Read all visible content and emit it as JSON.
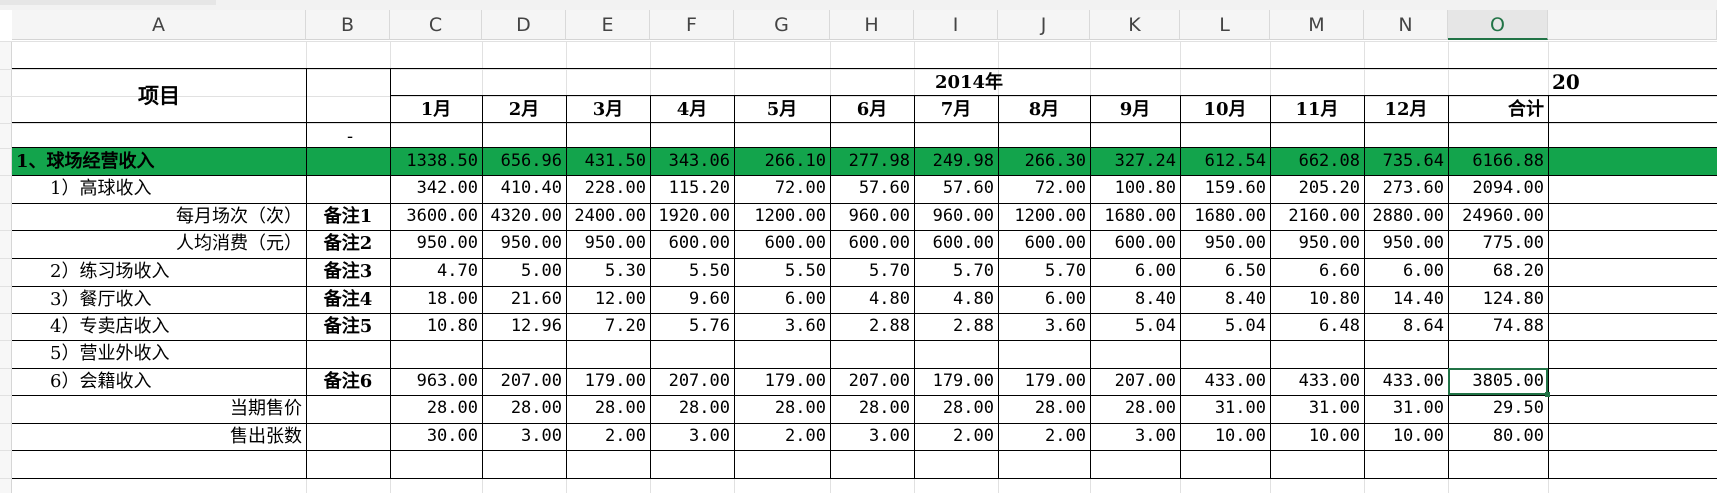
{
  "columns": [
    "A",
    "B",
    "C",
    "D",
    "E",
    "F",
    "G",
    "H",
    "I",
    "J",
    "K",
    "L",
    "M",
    "N",
    "O"
  ],
  "selected_column": "O",
  "header": {
    "item_label": "项目",
    "year_label": "2014年",
    "next_year_partial": "20",
    "months": [
      "1月",
      "2月",
      "3月",
      "4月",
      "5月",
      "6月",
      "7月",
      "8月",
      "9月",
      "10月",
      "11月",
      "12月"
    ],
    "total_label": "合计",
    "dash": "-"
  },
  "rows": [
    {
      "label": "1、球场经营收入",
      "note": "",
      "values": [
        "1338.50",
        "656.96",
        "431.50",
        "343.06",
        "266.10",
        "277.98",
        "249.98",
        "266.30",
        "327.24",
        "612.54",
        "662.08",
        "735.64",
        "6166.88"
      ]
    },
    {
      "label": "1）高球收入",
      "note": "",
      "values": [
        "342.00",
        "410.40",
        "228.00",
        "115.20",
        "72.00",
        "57.60",
        "57.60",
        "72.00",
        "100.80",
        "159.60",
        "205.20",
        "273.60",
        "2094.00"
      ]
    },
    {
      "label": "每月场次（次）",
      "note": "备注1",
      "values": [
        "3600.00",
        "4320.00",
        "2400.00",
        "1920.00",
        "1200.00",
        "960.00",
        "960.00",
        "1200.00",
        "1680.00",
        "1680.00",
        "2160.00",
        "2880.00",
        "24960.00"
      ]
    },
    {
      "label": "人均消费（元）",
      "note": "备注2",
      "values": [
        "950.00",
        "950.00",
        "950.00",
        "600.00",
        "600.00",
        "600.00",
        "600.00",
        "600.00",
        "600.00",
        "950.00",
        "950.00",
        "950.00",
        "775.00"
      ]
    },
    {
      "label": "2）练习场收入",
      "note": "备注3",
      "values": [
        "4.70",
        "5.00",
        "5.30",
        "5.50",
        "5.50",
        "5.70",
        "5.70",
        "5.70",
        "6.00",
        "6.50",
        "6.60",
        "6.00",
        "68.20"
      ]
    },
    {
      "label": "3）餐厅收入",
      "note": "备注4",
      "values": [
        "18.00",
        "21.60",
        "12.00",
        "9.60",
        "6.00",
        "4.80",
        "4.80",
        "6.00",
        "8.40",
        "8.40",
        "10.80",
        "14.40",
        "124.80"
      ]
    },
    {
      "label": "4）专卖店收入",
      "note": "备注5",
      "values": [
        "10.80",
        "12.96",
        "7.20",
        "5.76",
        "3.60",
        "2.88",
        "2.88",
        "3.60",
        "5.04",
        "5.04",
        "6.48",
        "8.64",
        "74.88"
      ]
    },
    {
      "label": "5）营业外收入",
      "note": "",
      "values": [
        "",
        "",
        "",
        "",
        "",
        "",
        "",
        "",
        "",
        "",
        "",
        "",
        ""
      ]
    },
    {
      "label": "6）会籍收入",
      "note": "备注6",
      "values": [
        "963.00",
        "207.00",
        "179.00",
        "207.00",
        "179.00",
        "207.00",
        "179.00",
        "179.00",
        "207.00",
        "433.00",
        "433.00",
        "433.00",
        "3805.00"
      ]
    },
    {
      "label": "当期售价",
      "note": "",
      "values": [
        "28.00",
        "28.00",
        "28.00",
        "28.00",
        "28.00",
        "28.00",
        "28.00",
        "28.00",
        "28.00",
        "31.00",
        "31.00",
        "31.00",
        "29.50"
      ]
    },
    {
      "label": "售出张数",
      "note": "",
      "values": [
        "30.00",
        "3.00",
        "2.00",
        "3.00",
        "2.00",
        "3.00",
        "2.00",
        "2.00",
        "3.00",
        "10.00",
        "10.00",
        "10.00",
        "80.00"
      ]
    }
  ],
  "colors": {
    "green_fill": "#13a44c",
    "selection": "#217346"
  }
}
